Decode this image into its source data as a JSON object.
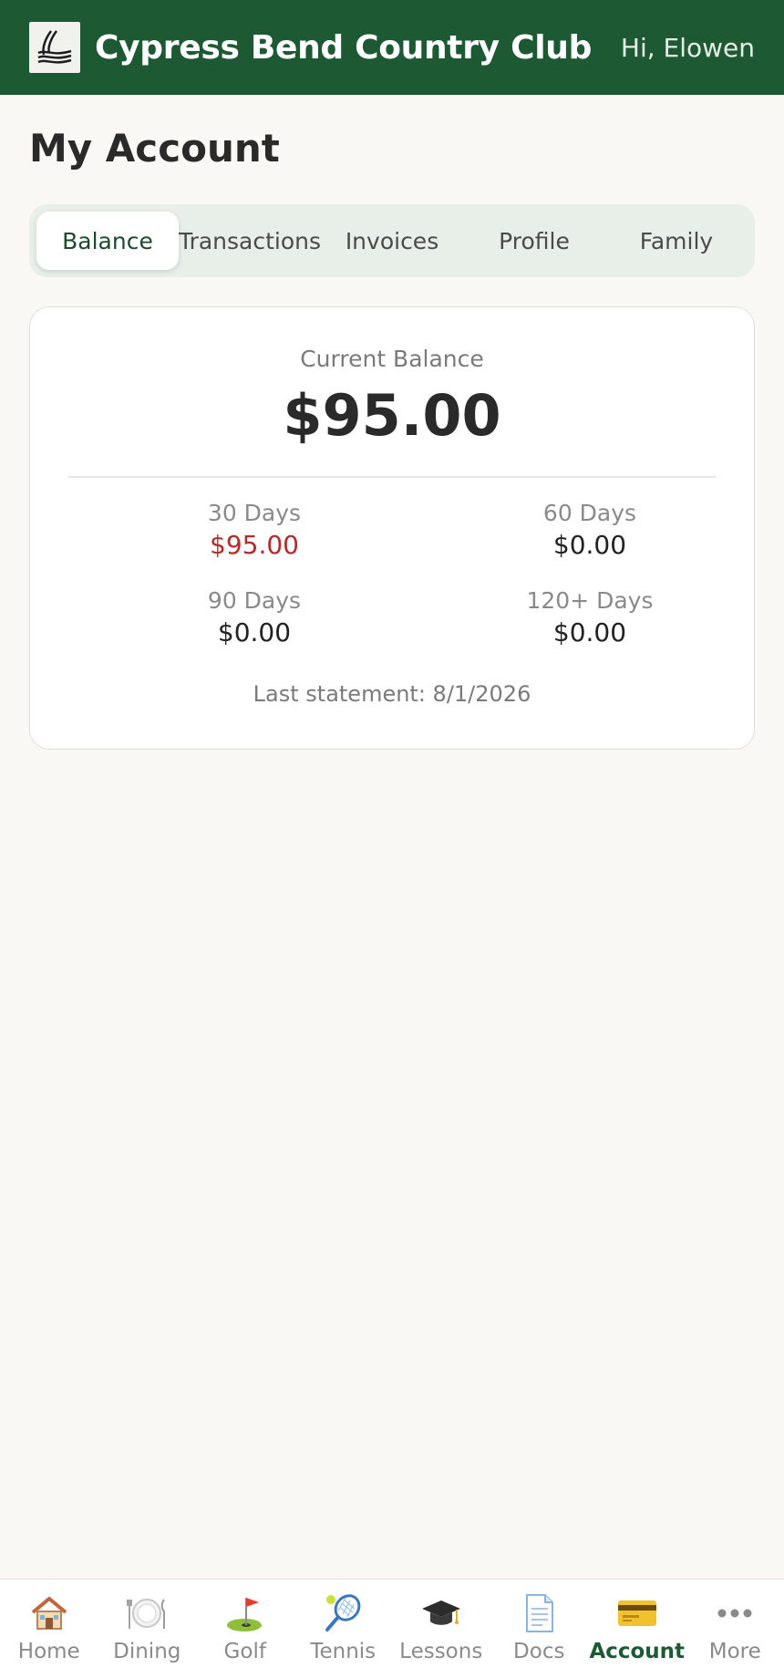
{
  "header": {
    "club_name": "Cypress Bend Country Club",
    "greeting": "Hi, Elowen",
    "logo_icon": "wave-logo-icon"
  },
  "page": {
    "title": "My Account"
  },
  "tabs": [
    {
      "label": "Balance",
      "active": true
    },
    {
      "label": "Transactions",
      "active": false
    },
    {
      "label": "Invoices",
      "active": false
    },
    {
      "label": "Profile",
      "active": false
    },
    {
      "label": "Family",
      "active": false
    }
  ],
  "balance": {
    "label": "Current Balance",
    "amount": "$95.00",
    "aging": {
      "d30": {
        "label": "30 Days",
        "value": "$95.00",
        "overdue": true
      },
      "d60": {
        "label": "60 Days",
        "value": "$0.00"
      },
      "d90": {
        "label": "90 Days",
        "value": "$0.00"
      },
      "d120": {
        "label": "120+ Days",
        "value": "$0.00"
      }
    },
    "last_statement": "Last statement: 8/1/2026"
  },
  "bottom_nav": [
    {
      "label": "Home",
      "icon": "house-icon",
      "active": false
    },
    {
      "label": "Dining",
      "icon": "plate-icon",
      "active": false
    },
    {
      "label": "Golf",
      "icon": "golf-flag-icon",
      "active": false
    },
    {
      "label": "Tennis",
      "icon": "tennis-racket-icon",
      "active": false
    },
    {
      "label": "Lessons",
      "icon": "graduation-cap-icon",
      "active": false
    },
    {
      "label": "Docs",
      "icon": "document-icon",
      "active": false
    },
    {
      "label": "Account",
      "icon": "credit-card-icon",
      "active": true
    },
    {
      "label": "More",
      "icon": "more-dots-icon",
      "active": false
    }
  ],
  "colors": {
    "brand": "#1d5a34",
    "overdue": "#b32b2b",
    "background": "#f9f8f5"
  }
}
